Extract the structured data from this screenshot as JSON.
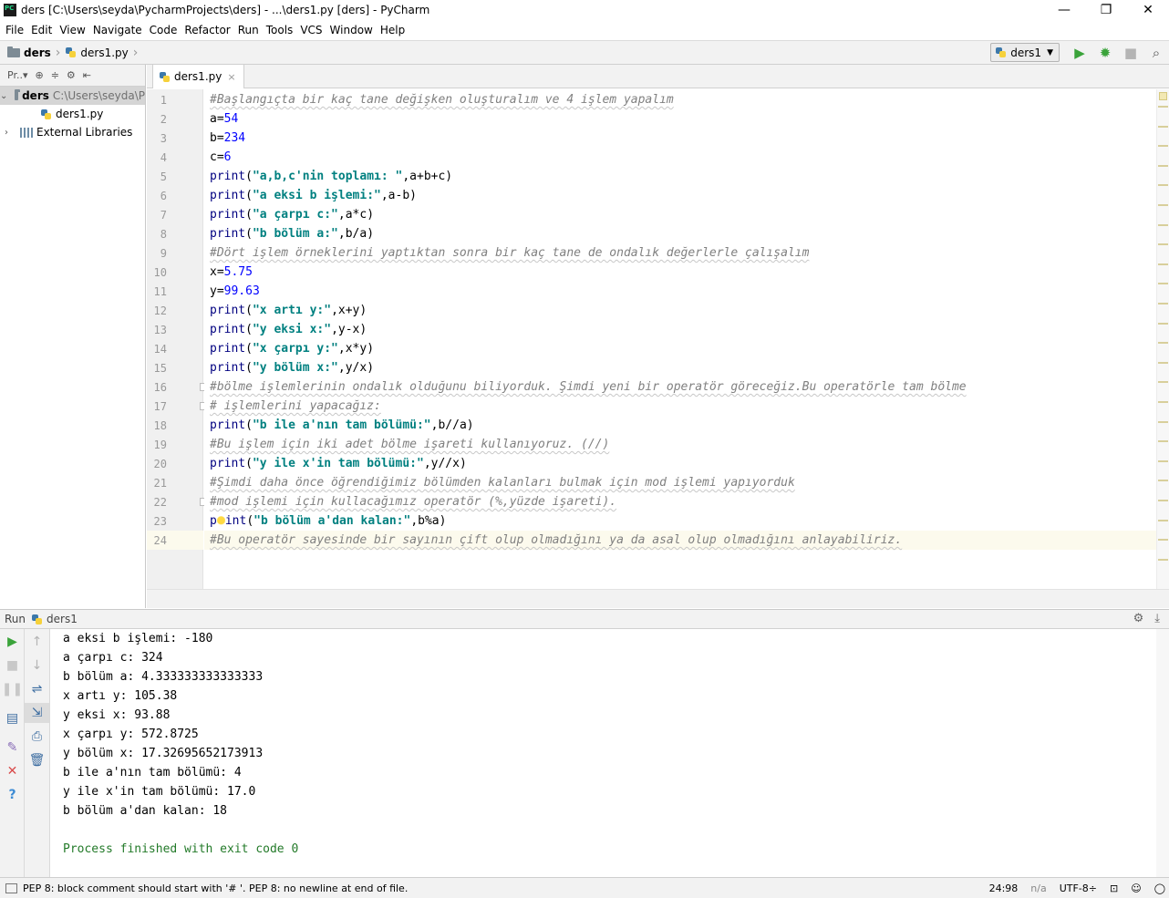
{
  "window": {
    "title": "ders [C:\\Users\\seyda\\PycharmProjects\\ders] - ...\\ders1.py [ders] - PyCharm",
    "minimize": "—",
    "restore": "❐",
    "close": "✕"
  },
  "menu": [
    "File",
    "Edit",
    "View",
    "Navigate",
    "Code",
    "Refactor",
    "Run",
    "Tools",
    "VCS",
    "Window",
    "Help"
  ],
  "navbar": {
    "project": "ders",
    "file": "ders1.py",
    "run_config": "ders1",
    "run_icon": "run-icon",
    "debug_icon": "debug-icon",
    "stop_icon": "stop-icon",
    "search_icon": "search-icon"
  },
  "project_panel": {
    "header_label": "Pr..▾",
    "tree": [
      {
        "label": "ders",
        "path": "C:\\Users\\seyda\\P"
      },
      {
        "label": "ders1.py"
      },
      {
        "label": "External Libraries"
      }
    ]
  },
  "editor": {
    "tab_label": "ders1.py",
    "tab_close": "×",
    "current_line": 24,
    "lines": [
      {
        "n": "1",
        "segs": [
          {
            "t": "#Başlangıçta bir kaç tane değişken oluşturalım ve 4 işlem yapalım",
            "c": "comment"
          }
        ]
      },
      {
        "n": "2",
        "segs": [
          {
            "t": "a=",
            "c": ""
          },
          {
            "t": "54",
            "c": "num"
          }
        ]
      },
      {
        "n": "3",
        "segs": [
          {
            "t": "b=",
            "c": ""
          },
          {
            "t": "234",
            "c": "num"
          }
        ]
      },
      {
        "n": "4",
        "segs": [
          {
            "t": "c=",
            "c": ""
          },
          {
            "t": "6",
            "c": "num"
          }
        ]
      },
      {
        "n": "5",
        "segs": [
          {
            "t": "print",
            "c": "kw"
          },
          {
            "t": "(",
            "c": ""
          },
          {
            "t": "\"a,b,c'nin toplamı: \"",
            "c": "str"
          },
          {
            "t": ",a+b+c)",
            "c": ""
          }
        ]
      },
      {
        "n": "6",
        "segs": [
          {
            "t": "print",
            "c": "kw"
          },
          {
            "t": "(",
            "c": ""
          },
          {
            "t": "\"a eksi b işlemi:\"",
            "c": "str"
          },
          {
            "t": ",a-b)",
            "c": ""
          }
        ]
      },
      {
        "n": "7",
        "segs": [
          {
            "t": "print",
            "c": "kw"
          },
          {
            "t": "(",
            "c": ""
          },
          {
            "t": "\"a çarpı c:\"",
            "c": "str"
          },
          {
            "t": ",a*c)",
            "c": ""
          }
        ]
      },
      {
        "n": "8",
        "segs": [
          {
            "t": "print",
            "c": "kw"
          },
          {
            "t": "(",
            "c": ""
          },
          {
            "t": "\"b bölüm a:\"",
            "c": "str"
          },
          {
            "t": ",b/a)",
            "c": ""
          }
        ]
      },
      {
        "n": "9",
        "segs": [
          {
            "t": "#Dört işlem örneklerini yaptıktan sonra bir kaç tane de ondalık değerlerle çalışalım",
            "c": "comment"
          }
        ]
      },
      {
        "n": "10",
        "segs": [
          {
            "t": "x=",
            "c": ""
          },
          {
            "t": "5.75",
            "c": "num"
          }
        ]
      },
      {
        "n": "11",
        "segs": [
          {
            "t": "y=",
            "c": ""
          },
          {
            "t": "99.63",
            "c": "num"
          }
        ]
      },
      {
        "n": "12",
        "segs": [
          {
            "t": "print",
            "c": "kw"
          },
          {
            "t": "(",
            "c": ""
          },
          {
            "t": "\"x artı y:\"",
            "c": "str"
          },
          {
            "t": ",x+y)",
            "c": ""
          }
        ]
      },
      {
        "n": "13",
        "segs": [
          {
            "t": "print",
            "c": "kw"
          },
          {
            "t": "(",
            "c": ""
          },
          {
            "t": "\"y eksi x:\"",
            "c": "str"
          },
          {
            "t": ",y-x)",
            "c": ""
          }
        ]
      },
      {
        "n": "14",
        "segs": [
          {
            "t": "print",
            "c": "kw"
          },
          {
            "t": "(",
            "c": ""
          },
          {
            "t": "\"x çarpı y:\"",
            "c": "str"
          },
          {
            "t": ",x*y)",
            "c": ""
          }
        ]
      },
      {
        "n": "15",
        "segs": [
          {
            "t": "print",
            "c": "kw"
          },
          {
            "t": "(",
            "c": ""
          },
          {
            "t": "\"y bölüm x:\"",
            "c": "str"
          },
          {
            "t": ",y/x)",
            "c": ""
          }
        ]
      },
      {
        "n": "16",
        "segs": [
          {
            "t": "#bölme işlemlerinin ondalık olduğunu biliyorduk. Şimdi yeni bir operatör göreceğiz.Bu operatörle tam bölme",
            "c": "comment"
          }
        ]
      },
      {
        "n": "17",
        "segs": [
          {
            "t": "# işlemlerini yapacağız:",
            "c": "comment"
          }
        ]
      },
      {
        "n": "18",
        "segs": [
          {
            "t": "print",
            "c": "kw"
          },
          {
            "t": "(",
            "c": ""
          },
          {
            "t": "\"b ile a'nın tam bölümü:\"",
            "c": "str"
          },
          {
            "t": ",b//a)",
            "c": ""
          }
        ]
      },
      {
        "n": "19",
        "segs": [
          {
            "t": "#Bu işlem için iki adet bölme işareti kullanıyoruz. (//)",
            "c": "comment"
          }
        ]
      },
      {
        "n": "20",
        "segs": [
          {
            "t": "print",
            "c": "kw"
          },
          {
            "t": "(",
            "c": ""
          },
          {
            "t": "\"y ile x'in tam bölümü:\"",
            "c": "str"
          },
          {
            "t": ",y//x)",
            "c": ""
          }
        ]
      },
      {
        "n": "21",
        "segs": [
          {
            "t": "#Şimdi daha önce öğrendiğimiz bölümden kalanları bulmak için mod işlemi yapıyorduk",
            "c": "comment"
          }
        ]
      },
      {
        "n": "22",
        "segs": [
          {
            "t": "#mod işlemi için kullacağımız operatör (%,yüzde işareti).",
            "c": "comment"
          }
        ]
      },
      {
        "n": "23",
        "segs": [
          {
            "t": "p",
            "c": "kw"
          },
          {
            "t": "",
            "c": "bulb"
          },
          {
            "t": "int",
            "c": "kw"
          },
          {
            "t": "(",
            "c": ""
          },
          {
            "t": "\"b bölüm a'dan kalan:\"",
            "c": "str"
          },
          {
            "t": ",b%a)",
            "c": ""
          }
        ]
      },
      {
        "n": "24",
        "segs": [
          {
            "t": "#Bu operatör sayesinde bir sayının çift olup olmadığını ya da asal olup olmadığını anlayabiliriz.",
            "c": "comment"
          }
        ]
      }
    ]
  },
  "run_panel": {
    "label": "Run",
    "config": "ders1",
    "output": [
      "a eksi b işlemi: -180",
      "a çarpı c: 324",
      "b bölüm a: 4.333333333333333",
      "x artı y: 105.38",
      "y eksi x: 93.88",
      "x çarpı y: 572.8725",
      "y bölüm x: 17.32695652173913",
      "b ile a'nın tam bölümü: 4",
      "y ile x'in tam bölümü: 17.0",
      "b bölüm a'dan kalan: 18",
      "",
      "Process finished with exit code 0"
    ]
  },
  "statusbar": {
    "message": "PEP 8: block comment should start with '# '. PEP 8: no newline at end of file.",
    "position": "24:98",
    "na": "n/a",
    "encoding": "UTF-8÷"
  },
  "colors": {
    "comment": "#808080",
    "number": "#0000ff",
    "string": "#008080",
    "keyword": "#000080",
    "current_line": "#fcfaed",
    "process_text": "#237a29"
  }
}
